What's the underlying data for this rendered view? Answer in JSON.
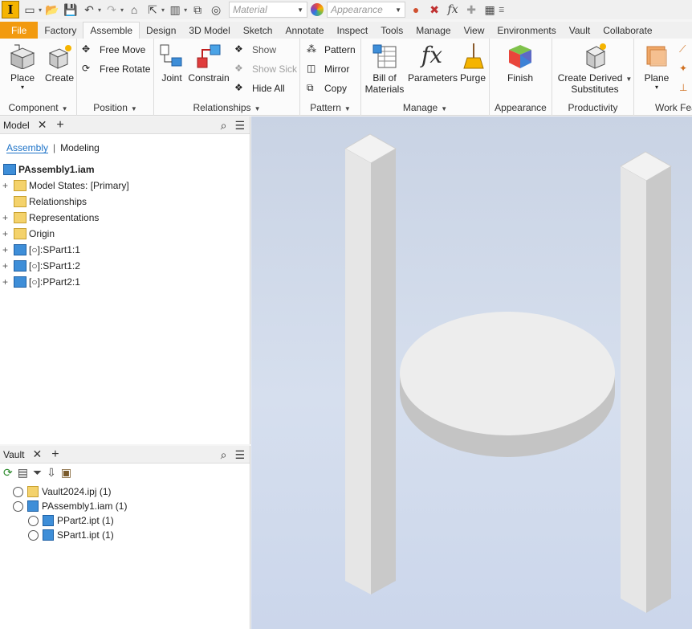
{
  "qat": {
    "app_letter": "I",
    "material_value": "Material",
    "appearance_value": "Appearance",
    "fx_label": "fx"
  },
  "tabs": [
    "File",
    "Factory",
    "Assemble",
    "Design",
    "3D Model",
    "Sketch",
    "Annotate",
    "Inspect",
    "Tools",
    "Manage",
    "View",
    "Environments",
    "Vault",
    "Collaborate"
  ],
  "ribbon": {
    "component": {
      "title": "Component",
      "place": "Place",
      "create": "Create"
    },
    "position": {
      "title": "Position",
      "free_move": "Free Move",
      "free_rotate": "Free Rotate"
    },
    "relationships": {
      "title": "Relationships",
      "joint": "Joint",
      "constrain": "Constrain",
      "show": "Show",
      "show_sick": "Show Sick",
      "hide_all": "Hide All"
    },
    "pattern": {
      "title": "Pattern",
      "pattern": "Pattern",
      "mirror": "Mirror",
      "copy": "Copy"
    },
    "manage": {
      "title": "Manage",
      "bom_line1": "Bill of",
      "bom_line2": "Materials",
      "parameters": "Parameters",
      "purge": "Purge"
    },
    "appearance": {
      "title": "Appearance",
      "finish": "Finish"
    },
    "productivity": {
      "title": "Productivity",
      "line1": "Create Derived",
      "line2": "Substitutes"
    },
    "work_features": {
      "title": "Work Fea",
      "plane": "Plane"
    }
  },
  "model_panel": {
    "tab_label": "Model",
    "subtab_assembly": "Assembly",
    "subtab_modeling": "Modeling",
    "tree": [
      {
        "label": "PAssembly1.iam"
      },
      {
        "label": "Model States: [Primary]"
      },
      {
        "label": "Relationships"
      },
      {
        "label": "Representations"
      },
      {
        "label": "Origin"
      },
      {
        "label": "[○]:SPart1:1"
      },
      {
        "label": "[○]:SPart1:2"
      },
      {
        "label": "[○]:PPart2:1"
      }
    ]
  },
  "vault_panel": {
    "tab_label": "Vault",
    "items": [
      {
        "label": "Vault2024.ipj (1)"
      },
      {
        "label": "PAssembly1.iam (1)"
      },
      {
        "label": "PPart2.ipt (1)"
      },
      {
        "label": "SPart1.ipt (1)"
      }
    ]
  },
  "colors": {
    "file_tab": "#f29a0f",
    "accent_blue": "#1e73c8",
    "viewport_bg": "#d0daea",
    "part_face": "#ececec"
  }
}
